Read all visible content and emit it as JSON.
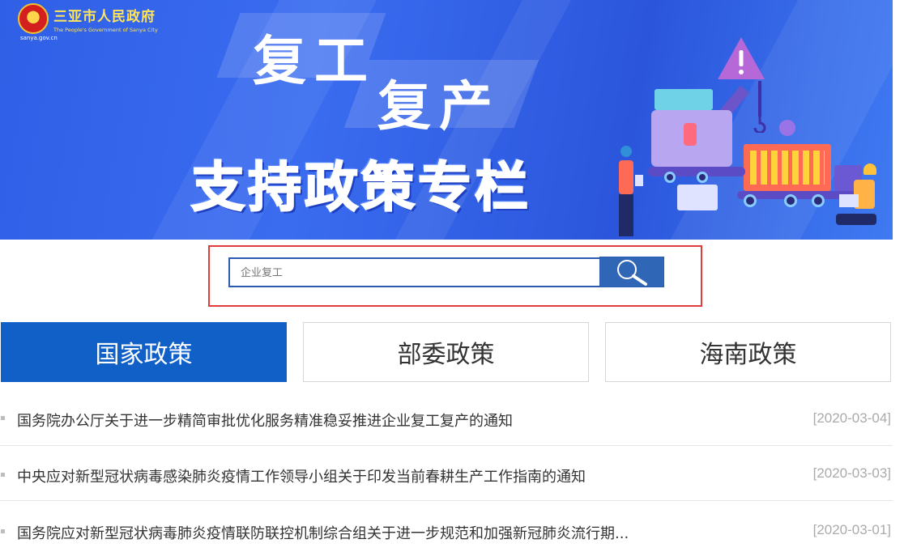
{
  "header": {
    "site_name_cn": "三亚市人民政府",
    "site_name_en": "The People's Government of Sanya City",
    "emblem_caption": "sanya.gov.cn"
  },
  "banner": {
    "line1": "复工",
    "line2": "复产",
    "line3": "支持政策专栏"
  },
  "search": {
    "placeholder": "企业复工",
    "icon": "search-icon"
  },
  "tabs": [
    {
      "label": "国家政策",
      "active": true
    },
    {
      "label": "部委政策",
      "active": false
    },
    {
      "label": "海南政策",
      "active": false
    }
  ],
  "articles": [
    {
      "title": "国务院办公厅关于进一步精简审批优化服务精准稳妥推进企业复工复产的通知",
      "date": "[2020-03-04]"
    },
    {
      "title": "中央应对新型冠状病毒感染肺炎疫情工作领导小组关于印发当前春耕生产工作指南的通知",
      "date": "[2020-03-03]"
    },
    {
      "title": "国务院应对新型冠状病毒肺炎疫情联防联控机制综合组关于进一步规范和加强新冠肺炎流行期...",
      "date": "[2020-03-01]"
    }
  ],
  "colors": {
    "banner_blue": "#2f5fe6",
    "active_tab": "#1060c8",
    "search_button": "#2f66b6",
    "highlight_frame": "#e23b3b",
    "logo_text": "#ffe45c"
  }
}
